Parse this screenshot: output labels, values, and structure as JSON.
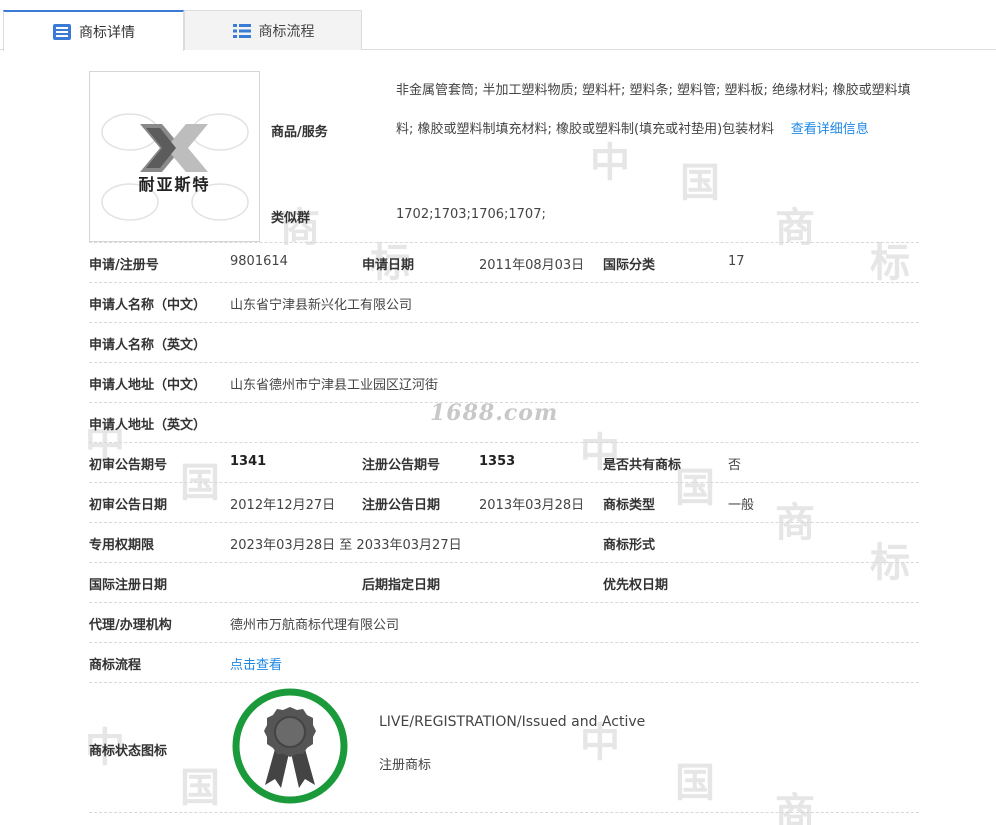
{
  "tabs": {
    "detail": "商标详情",
    "flow": "商标流程"
  },
  "logo": {
    "brand_text": "耐亚斯特"
  },
  "goods": {
    "label": "商品/服务",
    "text": "非金属管套筒; 半加工塑料物质; 塑料杆; 塑料条; 塑料管; 塑料板; 绝缘材料; 橡胶或塑料填料; 橡胶或塑料制填充材料; 橡胶或塑料制(填充或衬垫用)包装材料",
    "more_link": "查看详细信息"
  },
  "similar_group": {
    "label": "类似群",
    "value": "1702;1703;1706;1707;"
  },
  "rows": {
    "reg_no_label": "申请/注册号",
    "reg_no": "9801614",
    "apply_date_label": "申请日期",
    "apply_date": "2011年08月03日",
    "intl_class_label": "国际分类",
    "intl_class": "17",
    "applicant_cn_label": "申请人名称（中文）",
    "applicant_cn": "山东省宁津县新兴化工有限公司",
    "applicant_en_label": "申请人名称（英文）",
    "address_cn_label": "申请人地址（中文）",
    "address_cn": "山东省德州市宁津县工业园区辽河街",
    "address_en_label": "申请人地址（英文）",
    "prelim_no_label": "初审公告期号",
    "prelim_no": "1341",
    "reg_pub_no_label": "注册公告期号",
    "reg_pub_no": "1353",
    "shared_label": "是否共有商标",
    "shared": "否",
    "prelim_date_label": "初审公告日期",
    "prelim_date": "2012年12月27日",
    "reg_pub_date_label": "注册公告日期",
    "reg_pub_date": "2013年03月28日",
    "tm_type_label": "商标类型",
    "tm_type": "一般",
    "exclusive_label": "专用权期限",
    "exclusive": "2023年03月28日 至 2033年03月27日",
    "tm_form_label": "商标形式",
    "intl_reg_date_label": "国际注册日期",
    "later_date_label": "后期指定日期",
    "priority_date_label": "优先权日期",
    "agent_label": "代理/办理机构",
    "agent": "德州市万航商标代理有限公司",
    "flow_label": "商标流程",
    "flow_link": "点击查看",
    "status_icon_label": "商标状态图标",
    "status_en": "LIVE/REGISTRATION/Issued and Active",
    "status_cn": "注册商标"
  },
  "watermark_1688": "1688.com",
  "colors": {
    "accent": "#3a7bd5",
    "link": "#1e88e5",
    "status_ring": "#1a9a3a"
  }
}
